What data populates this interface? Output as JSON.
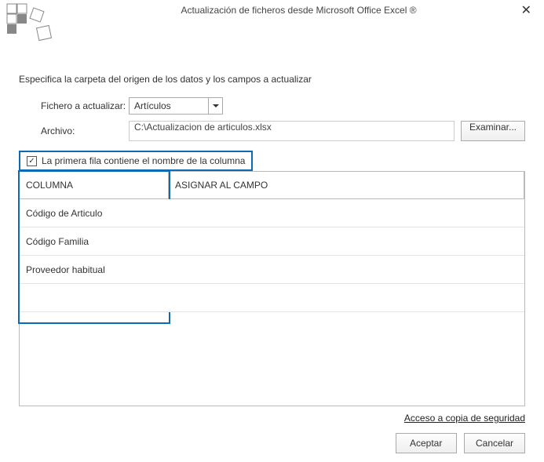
{
  "title": "Actualización de ficheros desde Microsoft Office Excel ®",
  "close_glyph": "✕",
  "instruction": "Especifica la carpeta del origen de los datos y los campos a actualizar",
  "labels": {
    "file_to_update": "Fichero a actualizar:",
    "archive": "Archivo:",
    "browse": "Examinar...",
    "first_row_header": "La primera fila contiene el nombre de la columna",
    "column_header": "COLUMNA",
    "assign_header": "ASIGNAR AL CAMPO",
    "backup_link": "Acceso a copia de seguridad",
    "accept": "Aceptar",
    "cancel": "Cancelar"
  },
  "combo_value": "Artículos",
  "path_value": "C:\\Actualizacion de articulos.xlsx",
  "check_glyph": "✓",
  "columns": [
    "Código de Articulo",
    "Código Familia",
    "Proveedor habitual"
  ]
}
